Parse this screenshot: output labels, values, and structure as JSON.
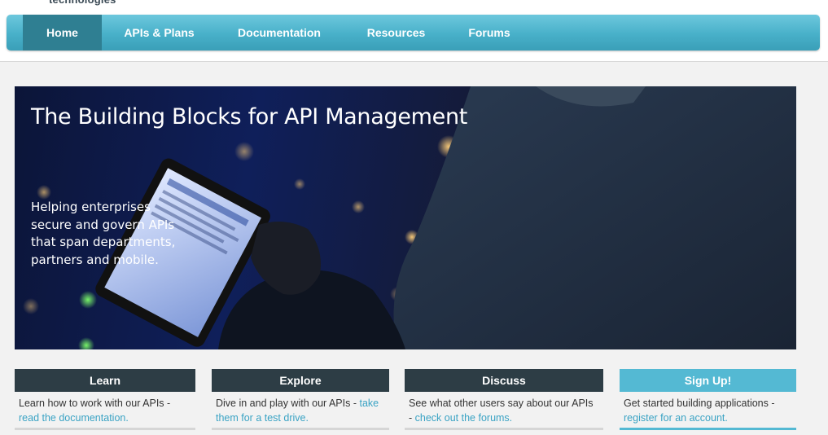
{
  "brand": {
    "logo_text": "technologies"
  },
  "nav": {
    "items": [
      {
        "label": "Home"
      },
      {
        "label": "APIs & Plans"
      },
      {
        "label": "Documentation"
      },
      {
        "label": "Resources"
      },
      {
        "label": "Forums"
      }
    ]
  },
  "hero": {
    "title": "The Building Blocks for API Management",
    "subtitle": "Helping enterprises secure and govern APIs that span departments, partners and mobile."
  },
  "cards": [
    {
      "title": "Learn",
      "text": "Learn how to work with our APIs -",
      "link": "read the documentation."
    },
    {
      "title": "Explore",
      "text": "Dive in and play with our APIs -",
      "link": "take them for a test drive."
    },
    {
      "title": "Discuss",
      "text": "See what other users say about our APIs -",
      "link": "check out the forums."
    },
    {
      "title": "Sign Up!",
      "text": "Get started building applications -",
      "link": "register for an account."
    }
  ],
  "colors": {
    "nav_accent": "#48b0c9",
    "nav_active": "#2f7f92",
    "card_head": "#2d3d45",
    "signup": "#54b9d3",
    "link": "#3aa3c4"
  }
}
